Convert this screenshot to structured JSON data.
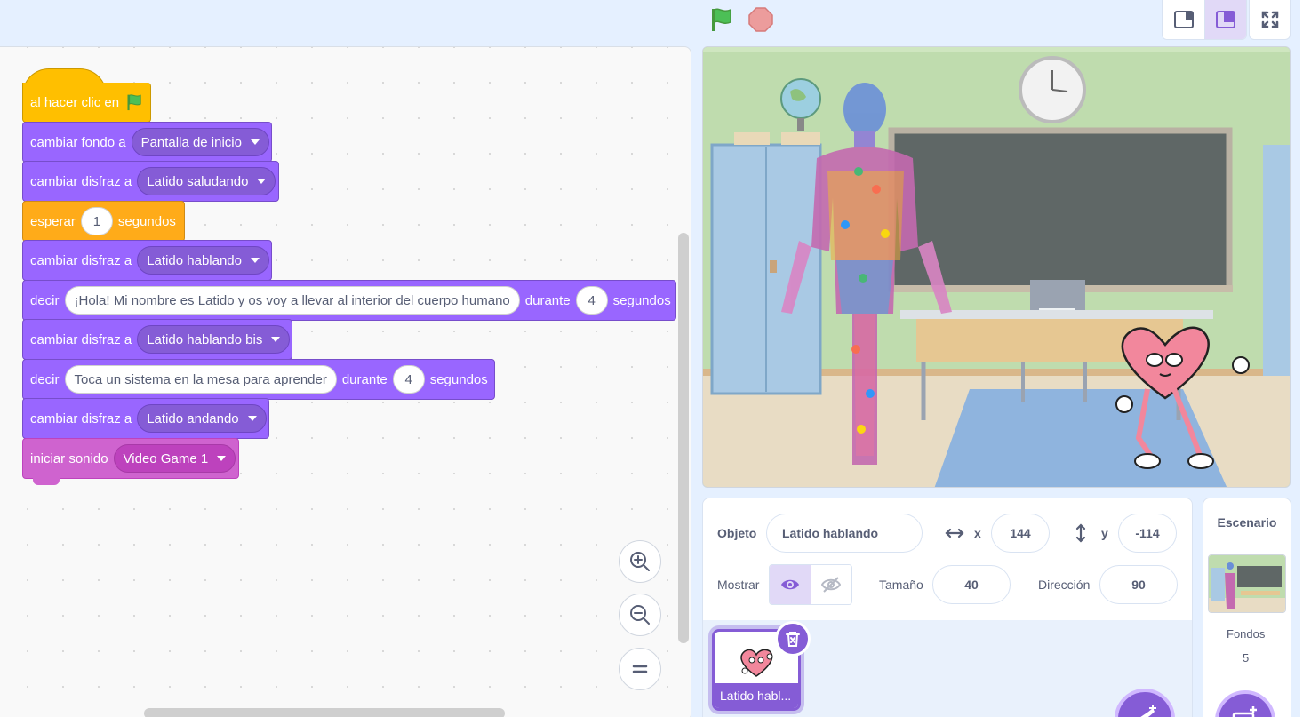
{
  "code": {
    "hat": {
      "label": "al hacer clic en"
    },
    "blocks": [
      {
        "label": "cambiar fondo a",
        "dropdown": "Pantalla de inicio"
      },
      {
        "label": "cambiar disfraz a",
        "dropdown": "Latido saludando"
      },
      {
        "label": "esperar",
        "value": "1",
        "suffix": "segundos"
      },
      {
        "label": "cambiar disfraz a",
        "dropdown": "Latido hablando"
      },
      {
        "label": "decir",
        "text": "¡Hola! Mi nombre es Latido y os voy a llevar al interior del cuerpo humano",
        "mid": "durante",
        "value": "4",
        "suffix": "segundos"
      },
      {
        "label": "cambiar disfraz a",
        "dropdown": "Latido hablando bis"
      },
      {
        "label": "decir",
        "text": "Toca un sistema en la mesa para aprender",
        "mid": "durante",
        "value": "4",
        "suffix": "segundos"
      },
      {
        "label": "cambiar disfraz a",
        "dropdown": "Latido andando"
      },
      {
        "label": "iniciar sonido",
        "dropdown": "Video Game 1"
      }
    ]
  },
  "sprite_info": {
    "object_label": "Objeto",
    "object_name": "Latido hablando",
    "x_label": "x",
    "x_value": "144",
    "y_label": "y",
    "y_value": "-114",
    "show_label": "Mostrar",
    "size_label": "Tamaño",
    "size_value": "40",
    "direction_label": "Dirección",
    "direction_value": "90"
  },
  "sprite_list": [
    {
      "name": "Latido habl..."
    }
  ],
  "stage_selector": {
    "title": "Escenario",
    "backdrops_label": "Fondos",
    "backdrops_count": "5"
  },
  "colors": {
    "looks": "#9966ff",
    "control": "#ffab19",
    "events": "#ffbf00",
    "sound": "#cf63cf",
    "accent": "#855cd6"
  },
  "icons": [
    "green-flag-icon",
    "stop-icon",
    "small-stage-icon",
    "large-stage-icon",
    "fullscreen-icon",
    "zoom-in-icon",
    "zoom-out-icon",
    "zoom-reset-icon",
    "eye-icon",
    "eye-off-icon",
    "trash-icon",
    "add-sprite-icon",
    "add-backdrop-icon"
  ]
}
